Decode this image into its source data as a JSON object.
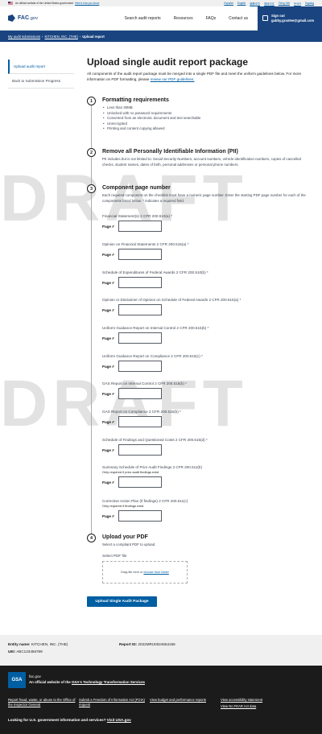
{
  "gov_banner": {
    "text": "An official website of the United States government",
    "how_link": "Here's how you know",
    "languages": [
      "Español",
      "English",
      "繁體中文",
      "简体中文",
      "Tiếng Việt",
      "한국어",
      "Tagalog"
    ]
  },
  "header": {
    "logo": "FAC",
    "logo_suffix": ".gov",
    "nav": [
      "Search audit reports",
      "Resources",
      "FAQs",
      "Contact us"
    ],
    "signout_label": "Sign out",
    "signout_email": "gabby.grantee@gmail.com"
  },
  "breadcrumb": {
    "items": [
      "My audit submissions",
      "KITCHEN, INC. (THE)"
    ],
    "current": "Upload report"
  },
  "sidebar": {
    "items": [
      {
        "label": "Upload audit report"
      },
      {
        "label": "Back to Submission Progress"
      }
    ]
  },
  "main": {
    "title": "Upload single audit report package",
    "intro": "All components of the audit report package must be merged into a single PDF file and meet the uniform guidelines below. For more information on PDF formatting, please",
    "intro_link": "review our PDF guidelines.",
    "steps": [
      {
        "num": "1",
        "title": "Formatting requirements",
        "bullets": [
          "Less than 30MB",
          "Unlocked with no password requirements",
          "Converted from an electronic document and text searchable",
          "Unencrypted",
          "Printing and content copying allowed"
        ]
      },
      {
        "num": "2",
        "title": "Remove all Personally Identifiable Information (PII)",
        "text": "PII includes but is not limited to: Social Security Numbers, account numbers, vehicle identification numbers, copies of cancelled checks, student names, dates of birth, personal addresses or personal phone numbers."
      },
      {
        "num": "3",
        "title": "Component page number",
        "text": "Each required component on the checklist must have a numeric page number. Enter the starting PDF page number for each of the components listed below. * indicates a required field."
      },
      {
        "num": "4",
        "title": "Upload your PDF",
        "text": "Select a compliant PDF to upload."
      }
    ],
    "page_label": "Page #",
    "fields": [
      {
        "label": "Financial Statement(s) 2 CFR 200.510(a) *",
        "hint": ""
      },
      {
        "label": "Opinion on Financial Statements 2 CFR 200.515(a) *",
        "hint": ""
      },
      {
        "label": "Schedule of Expenditures of Federal Awards 2 CFR 200.510(b) *",
        "hint": ""
      },
      {
        "label": "Opinion or Disclaimer of Opinion on Schedule of Federal Awards 2 CFR 200.515(a) *",
        "hint": ""
      },
      {
        "label": "Uniform Guidance Report on Internal Control 2 CFR 200.515(b) *",
        "hint": ""
      },
      {
        "label": "Uniform Guidance Report on Compliance 2 CFR 200.515(c) *",
        "hint": ""
      },
      {
        "label": "GAS Report on Internal Control 2 CFR 200.515(b) *",
        "hint": ""
      },
      {
        "label": "GAS Report on Compliance 2 CFR 200.515(b) *",
        "hint": ""
      },
      {
        "label": "Schedule of Findings and Questioned Costs 2 CFR 200.515(d) *",
        "hint": ""
      },
      {
        "label": "Summary Schedule of Prior Audit Findings 2 CFR 200.511(b)",
        "hint": "Only required if prior audit findings exist"
      },
      {
        "label": "Corrective Action Plan (if findings) 2 CFR 200.511(c)",
        "hint": "Only required if findings exist"
      }
    ],
    "select_label": "Select PDF file",
    "drop_text": "Drag file here or",
    "drop_link": "choose from folder",
    "submit_label": "Upload Single Audit Package"
  },
  "watermark": "DRAFT",
  "entity": {
    "name_label": "Entity name:",
    "name": "KITCHEN, INC. (THE)",
    "report_label": "Report ID:",
    "report": "2022MRU0024654156",
    "uei_label": "UEI:",
    "uei": "ABC123456789"
  },
  "footer": {
    "gsa": "GSA",
    "domain": "fac.gov",
    "official": "An official website of the",
    "official_link": "GSA's Technology Transformation Services",
    "links": [
      [
        "Report fraud, waste, or abuse to the Office of the Inspector General"
      ],
      [
        "Submit a Freedom of Information Act (FOIA) request"
      ],
      [
        "View budget and performance reports"
      ],
      [
        "View accessibility statement",
        "View No FEAR Act data"
      ]
    ],
    "bottom_text": "Looking for U.S. government information and services?",
    "bottom_link": "Visit USA.gov"
  }
}
